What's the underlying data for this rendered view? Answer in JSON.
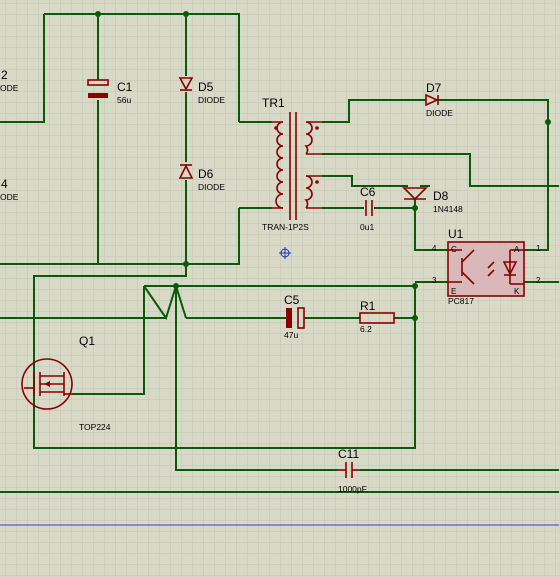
{
  "components": {
    "c1": {
      "ref": "C1",
      "value": "56u"
    },
    "d5": {
      "ref": "D5",
      "value": "DIODE"
    },
    "d6": {
      "ref": "D6",
      "value": "DIODE"
    },
    "tr1": {
      "ref": "TR1",
      "value": "TRAN-1P2S"
    },
    "d7": {
      "ref": "D7",
      "value": "DIODE"
    },
    "c6": {
      "ref": "C6",
      "value": "0u1"
    },
    "d8": {
      "ref": "D8",
      "value": "1N4148"
    },
    "u1": {
      "ref": "U1",
      "value": "PC817",
      "pins": {
        "c": "C",
        "e": "E",
        "a": "A",
        "k": "K",
        "p4": "4",
        "p3": "3",
        "p1": "1",
        "p2": "2"
      }
    },
    "c5": {
      "ref": "C5",
      "value": "47u"
    },
    "r1": {
      "ref": "R1",
      "value": "6.2"
    },
    "q1": {
      "ref": "Q1",
      "value": "TOP224"
    },
    "c11": {
      "ref": "C11",
      "value": "1000pF"
    }
  },
  "partial_labels": {
    "top_digit": "2",
    "top_text": "ODE",
    "mid_digit": "4",
    "mid_text": "ODE"
  },
  "colors": {
    "background": "#d9d9c8",
    "grid": "#c4c4b2",
    "wire": "#0a5a0a",
    "component": "#8a0000",
    "optocoupler_fill": "#d8b8b8",
    "marker": "#2030c0",
    "blue_rule": "#3a3ad0"
  }
}
